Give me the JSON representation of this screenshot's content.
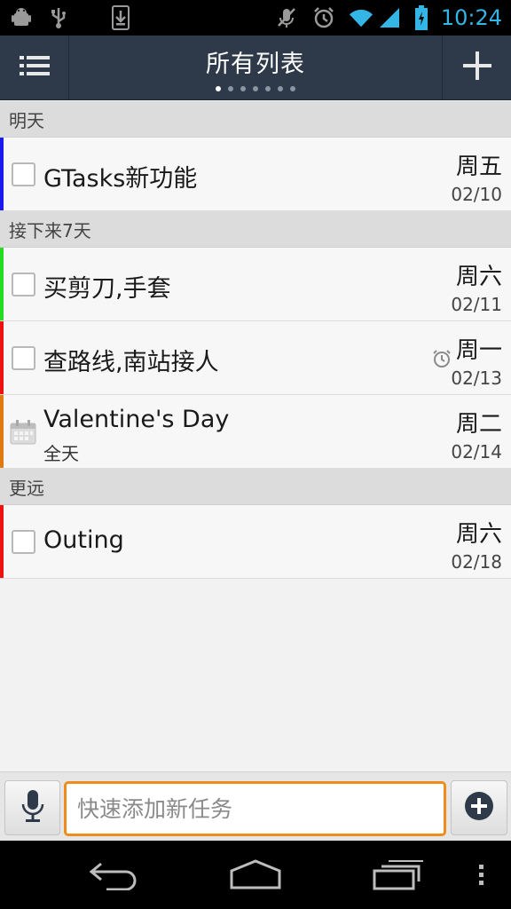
{
  "status_bar": {
    "time": "10:24",
    "left_icons": [
      "android-debug-icon",
      "usb-icon",
      "download-icon"
    ],
    "right_icons": [
      "mute-icon",
      "alarm-icon",
      "wifi-icon",
      "signal-icon",
      "battery-icon"
    ],
    "time_color": "#33b5e5"
  },
  "action_bar": {
    "title": "所有列表",
    "menu_icon": "list-menu-icon",
    "add_icon": "plus-icon",
    "page_count": 7,
    "active_page": 1
  },
  "sections": [
    {
      "header": "明天",
      "tasks": [
        {
          "title": "GTasks新功能",
          "day": "周五",
          "date": "02/10",
          "color": "#1a1aee",
          "type": "task"
        }
      ]
    },
    {
      "header": "接下来7天",
      "tasks": [
        {
          "title": "买剪刀,手套",
          "day": "周六",
          "date": "02/11",
          "color": "#22dd22",
          "type": "task"
        },
        {
          "title": "查路线,南站接人",
          "day": "周一",
          "date": "02/13",
          "color": "#ee1111",
          "type": "task",
          "alarm": true
        },
        {
          "title": "Valentine's Day",
          "subtitle": "全天",
          "day": "周二",
          "date": "02/14",
          "color": "#e07a10",
          "type": "event"
        }
      ]
    },
    {
      "header": "更远",
      "tasks": [
        {
          "title": "Outing",
          "day": "周六",
          "date": "02/18",
          "color": "#ee1111",
          "type": "task"
        }
      ]
    }
  ],
  "quick_add": {
    "placeholder": "快速添加新任务",
    "value": "",
    "accent": "#f08c1e"
  },
  "nav_bar": {
    "buttons": [
      "back-icon",
      "home-icon",
      "recents-icon",
      "overflow-menu-icon"
    ]
  }
}
